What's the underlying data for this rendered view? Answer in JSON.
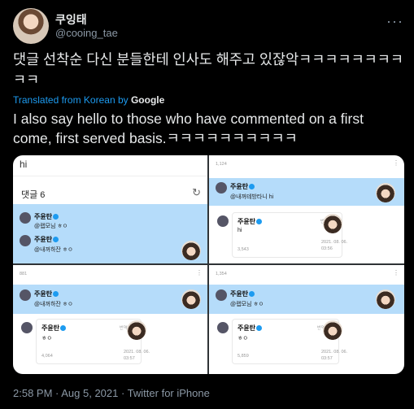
{
  "author": {
    "name": "쿠잉태",
    "handle": "@cooing_tae",
    "more": "···"
  },
  "tweet": {
    "text": "댓글 선착순 다신 분들한테 인사도 해주고 있잖악ㅋㅋㅋㅋㅋㅋㅋㅋㅋㅋ",
    "translated_prefix": "Translated from Korean by",
    "translated_by": "Google",
    "translation": "I also say hello to those who have commented on a first come, first served basis.ㅋㅋㅋㅋㅋㅋㅋㅋㅋㅋ"
  },
  "media": {
    "panel1": {
      "input": "hi",
      "comments_header": "댓글 6",
      "refresh_icon": "↻",
      "user": "주윤탄",
      "comments": [
        "@랩모님 ㅎㅇ",
        "@내꺼하잔 ㅎㅇ"
      ]
    },
    "panel2": {
      "count": "1,124",
      "user": "주윤탄",
      "comment": "@내꺼테방타니 hi",
      "reply_user": "주윤탄",
      "reply_action": "번역하기",
      "reply_text": "hi",
      "reply_likes": "3,543",
      "reply_date": "2021. 08. 06.",
      "reply_time": "03:56"
    },
    "panel3": {
      "count": "881",
      "user": "주윤탄",
      "comment": "@내꺼하잔 ㅎㅇ",
      "reply_user": "주윤탄",
      "reply_action": "번역하기",
      "reply_text": "ㅎㅇ",
      "reply_likes": "4,064",
      "reply_date": "2021. 08. 06.",
      "reply_time": "03:57"
    },
    "panel4": {
      "count": "1,354",
      "user": "주윤탄",
      "comment": "@랩모님 ㅎㅇ",
      "reply_user": "주윤탄",
      "reply_action": "번역하기",
      "reply_text": "ㅎㅇ",
      "reply_likes": "5,859",
      "reply_date": "2021. 08. 06.",
      "reply_time": "03:57"
    }
  },
  "footer": "2:58 PM · Aug 5, 2021 · Twitter for iPhone"
}
